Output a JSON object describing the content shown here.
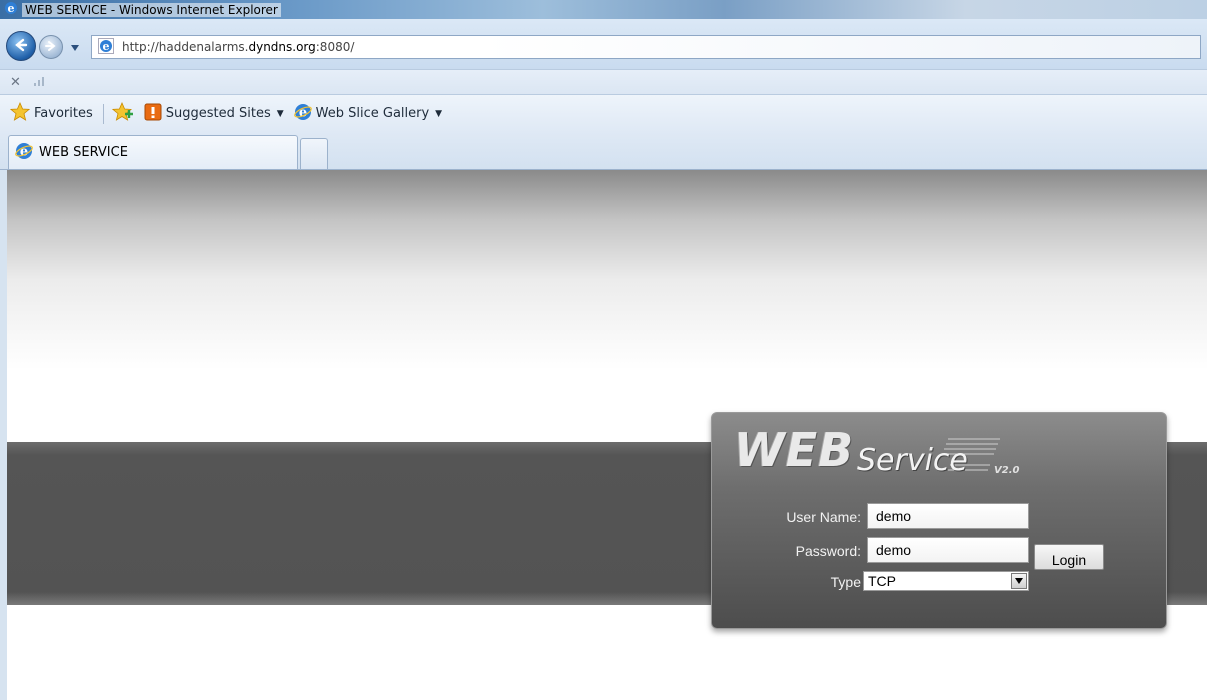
{
  "window": {
    "title": "WEB SERVICE - Windows Internet Explorer"
  },
  "addressbar": {
    "url_prefix": "http://haddenalarms.",
    "url_host": "dyndns.org",
    "url_suffix": ":8080/"
  },
  "favorites_bar": {
    "favorites_label": "Favorites",
    "suggested_sites_label": "Suggested Sites",
    "web_slice_gallery_label": "Web Slice Gallery"
  },
  "tabs": [
    {
      "label": "WEB SERVICE",
      "active": true
    }
  ],
  "login": {
    "logo_web": "WEB",
    "logo_service": "Service",
    "logo_version": "V2.0",
    "username_label": "User Name:",
    "username_value": "demo",
    "password_label": "Password:",
    "password_value": "demo",
    "type_label": "Type",
    "type_selected": "TCP",
    "login_button": "Login"
  },
  "colors": {
    "band": "#555555",
    "panel": "#6e6e6e",
    "chrome": "#dbe8f6"
  }
}
